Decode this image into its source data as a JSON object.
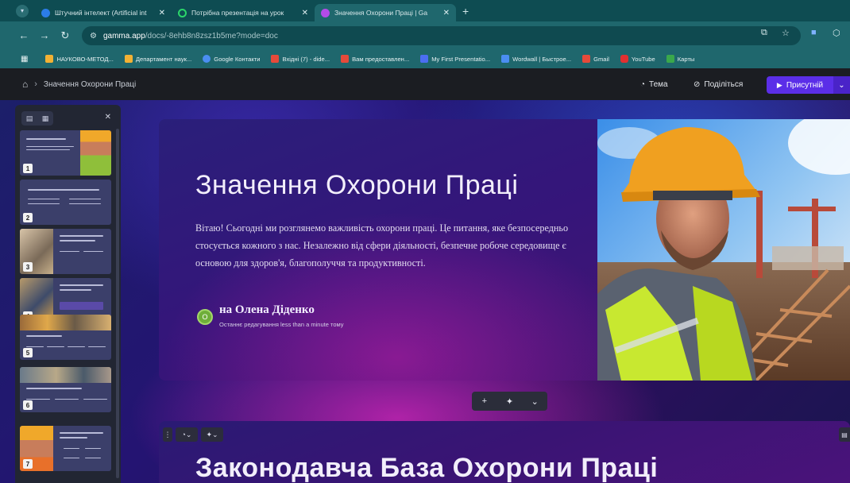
{
  "browser": {
    "tabs": [
      {
        "label": "Штучний інтелект (Artificial int",
        "favicon_color": "#2b7de9",
        "active": false
      },
      {
        "label": "Потрібна презентація на урок",
        "favicon_color": "#2bd66a",
        "active": false
      },
      {
        "label": "Значення Охорони Праці | Ga",
        "favicon_color": "#b44be8",
        "active": true
      }
    ],
    "url_domain": "gamma.app",
    "url_path": "/docs/-8ehb8n8zsz1b5me?mode=doc",
    "bookmarks": [
      {
        "label": "НАУКОВО-МЕТОД...",
        "color": "#f2b134"
      },
      {
        "label": "Департамент наук...",
        "color": "#f2b134"
      },
      {
        "label": "Google Контакти",
        "color": "#4b8ef2"
      },
      {
        "label": "Вхідні (7) - dide...",
        "color": "#e64a3a"
      },
      {
        "label": "Вам предоставлен...",
        "color": "#e64a3a"
      },
      {
        "label": "My First Presentatio...",
        "color": "#4b6ef2"
      },
      {
        "label": "Wordwall | Быстрое...",
        "color": "#4b8ef2"
      },
      {
        "label": "Gmail",
        "color": "#e64a3a"
      },
      {
        "label": "YouTube",
        "color": "#e23030"
      },
      {
        "label": "Карты",
        "color": "#3aa84b"
      }
    ]
  },
  "app": {
    "breadcrumb": "Значення Охорони Праці",
    "theme_label": "Тема",
    "share_label": "Поділіться",
    "present_label": "Присутній",
    "accent": "#5b2ee8"
  },
  "thumbnails": [
    "1",
    "2",
    "3",
    "4",
    "5",
    "6",
    "7"
  ],
  "slide1": {
    "title": "Значення Охорони Праці",
    "body": "Вітаю! Сьогодні ми розглянемо важливість охорони праці. Це питання, яке безпосередньо стосується кожного з нас. Незалежно від сфери діяльності, безпечне робоче середовище є основою для здоров'я, благополуччя та продуктивності.",
    "author_initial": "О",
    "author": "на Олена Діденко",
    "edited": "Останнє редагування less than a minute тому"
  },
  "floating_toolbar": {
    "add": "+",
    "ai": "✦",
    "more": "⌄"
  },
  "slide2": {
    "title": "Законодавча База Охорони Праці"
  }
}
